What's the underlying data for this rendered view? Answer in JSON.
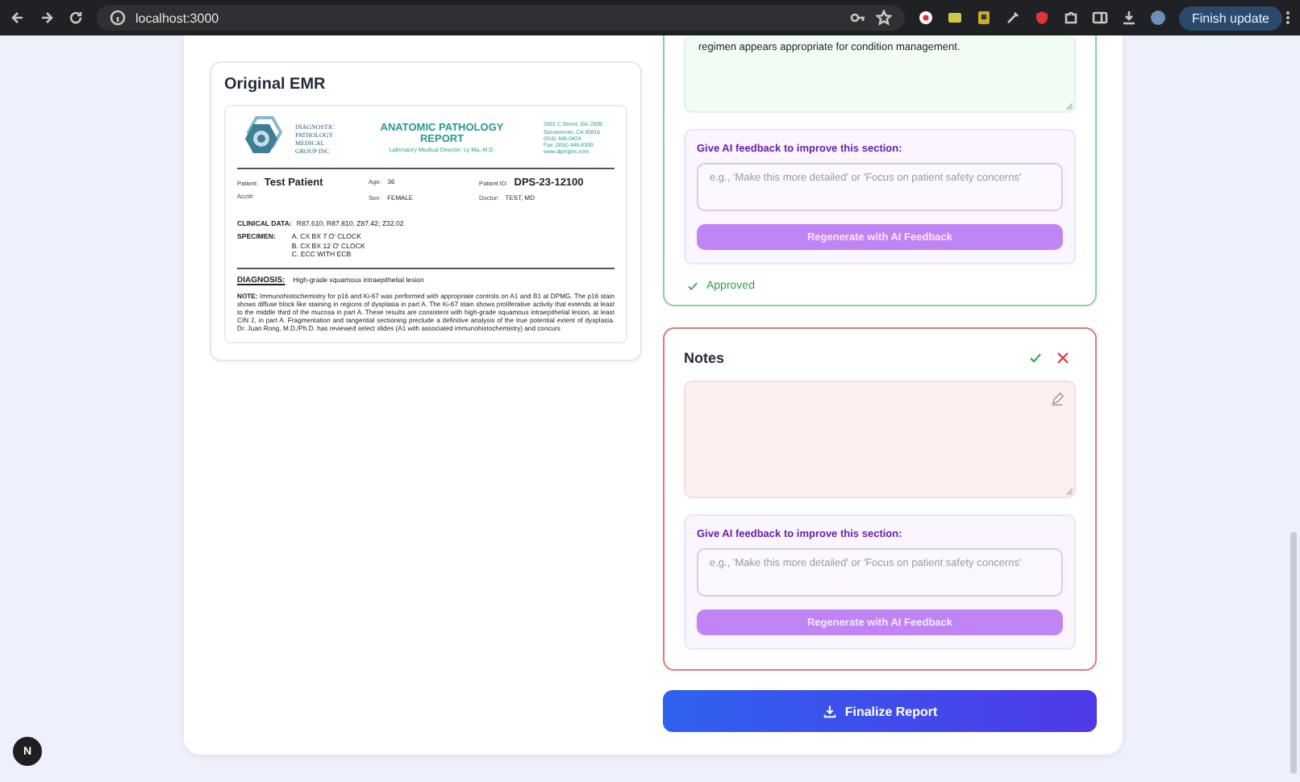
{
  "browser": {
    "url": "localhost:3000",
    "update_button": "Finish update"
  },
  "emr": {
    "title": "Original EMR",
    "document": {
      "logo_lines": [
        "DIAGNOSTIC",
        "PATHOLOGY",
        "MEDICAL",
        "GROUP INC"
      ],
      "report_title": [
        "ANATOMIC PATHOLOGY",
        "REPORT"
      ],
      "director": "Laboratory Medical Director: Ly Ma, M.D.",
      "address": [
        "3301 C Street, Ste 200E",
        "Sacramento, CA 95816",
        "(916) 446-0424",
        "Fax: (916) 446-8330",
        "www.dpmginc.com"
      ],
      "fields": [
        {
          "label": "Patient:",
          "value": "Test Patient",
          "kind": "strong"
        },
        {
          "label": "Age:",
          "value": "36",
          "kind": "plain"
        },
        {
          "label": "Patient ID:",
          "value": "DPS-23-12100",
          "kind": "strong"
        },
        {
          "label": "Acct#:",
          "kind": "plain"
        },
        {
          "label": "Sex:",
          "value": "FEMALE",
          "kind": "plain"
        },
        {
          "label": "Doctor:",
          "value": "TEST, MD",
          "kind": "plain"
        }
      ],
      "clinical_label": "CLINICAL DATA:",
      "clinical_value": "R87.610; R87.810; Z87.42; Z32.02",
      "specimen_label": "SPECIMEN:",
      "specimen_lines": [
        "A. CX BX 7 O' CLOCK",
        "B. CX BX 12 O' CLOCK",
        "C. ECC WITH ECB"
      ],
      "diagnosis_label": "DIAGNOSIS:",
      "diagnosis_value": "High-grade squamous intraepithelial lesion",
      "note": "**NOTE:** Immunohistochemistry for p16 and Ki-67 was performed with appropriate controls on A1 and B1 at DPMG. The p16 stain shows diffuse block like staining in regions of dysplasia in part A. The Ki-67 stain shows proliferative activity that extends at least to the middle third of the mucosa in part A. These results are consistent with high-grade squamous intraepithelial lesion, at least CIN 2, in part A. Fragmentation and tangential sectioning preclude a definitive analysis of the true potential extent of dysplasia. Dr. Juan Rong, M.D./Ph.D. has reviewed select slides (A1 with associated immunohistochemistry) and concurs"
    }
  },
  "sections": [
    {
      "kind": "approved",
      "content": "regimen appears appropriate for condition management.",
      "feedback": {
        "label": "Give AI feedback to improve this section:",
        "placeholder": "e.g., 'Make this more detailed' or 'Focus on patient safety concerns'",
        "button": "Regenerate with AI Feedback",
        "disabled": true
      },
      "status_label": "Approved"
    },
    {
      "kind": "review",
      "title": "Notes",
      "feedback": {
        "label": "Give AI feedback to improve this section:",
        "placeholder": "e.g., 'Make this more detailed' or 'Focus on patient safety concerns'",
        "button": "Regenerate with AI Feedback",
        "disabled": true
      }
    }
  ],
  "finalize_button": "Finalize Report",
  "dev_badge": "N"
}
